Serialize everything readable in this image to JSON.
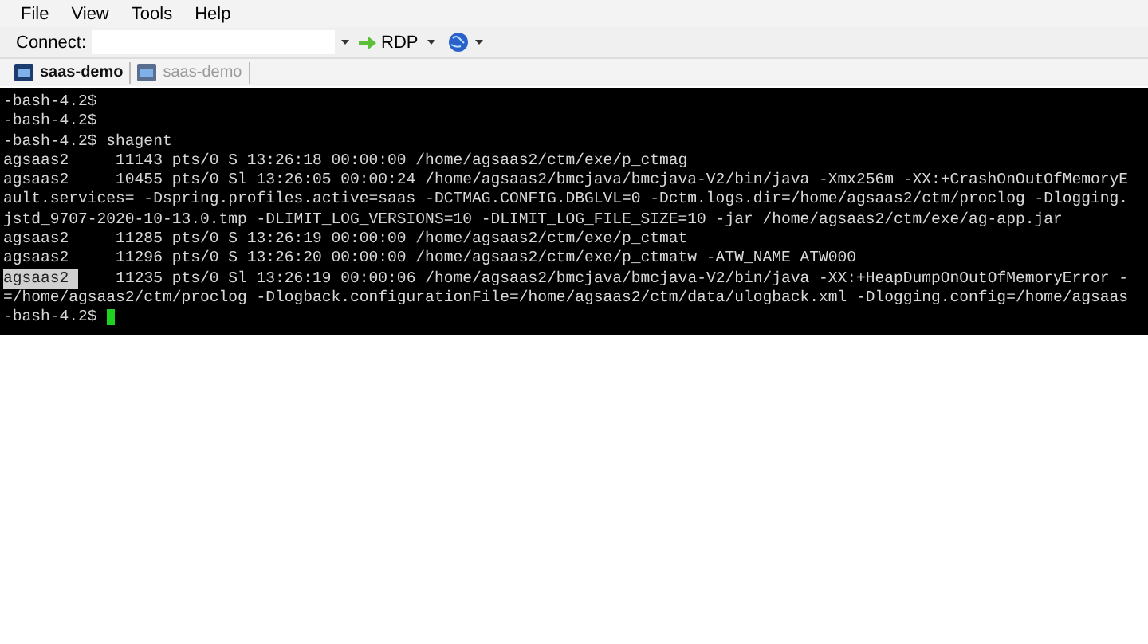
{
  "menu": [
    "File",
    "View",
    "Tools",
    "Help"
  ],
  "toolbar": {
    "connect_label": "Connect:",
    "rdp_label": "RDP"
  },
  "tabs": [
    {
      "label": "saas-demo",
      "selected": true
    },
    {
      "label": "saas-demo",
      "selected": false
    }
  ],
  "terminal": {
    "lines": [
      [
        {
          "text": "-bash-4.2$",
          "selected": false
        }
      ],
      [
        {
          "text": "-bash-4.2$",
          "selected": false
        }
      ],
      [
        {
          "text": "-bash-4.2$ shagent",
          "selected": false
        }
      ],
      [
        {
          "text": "agsaas2     11143 pts/0 S 13:26:18 00:00:00 /home/agsaas2/ctm/exe/p_ctmag",
          "selected": false
        }
      ],
      [
        {
          "text": "agsaas2     10455 pts/0 Sl 13:26:05 00:00:24 /home/agsaas2/bmcjava/bmcjava-V2/bin/java -Xmx256m -XX:+CrashOnOutOfMemoryE",
          "selected": false
        }
      ],
      [
        {
          "text": "ault.services= -Dspring.profiles.active=saas -DCTMAG.CONFIG.DBGLVL=0 -Dctm.logs.dir=/home/agsaas2/ctm/proclog -Dlogging.",
          "selected": false
        }
      ],
      [
        {
          "text": "jstd_9707-2020-10-13.0.tmp -DLIMIT_LOG_VERSIONS=10 -DLIMIT_LOG_FILE_SIZE=10 -jar /home/agsaas2/ctm/exe/ag-app.jar",
          "selected": false
        }
      ],
      [
        {
          "text": "agsaas2     11285 pts/0 S 13:26:19 00:00:00 /home/agsaas2/ctm/exe/p_ctmat",
          "selected": false
        }
      ],
      [
        {
          "text": "agsaas2     11296 pts/0 S 13:26:20 00:00:00 /home/agsaas2/ctm/exe/p_ctmatw -ATW_NAME ATW000",
          "selected": false
        }
      ],
      [
        {
          "text": "agsaas2 ",
          "selected": true
        },
        {
          "text": "    11235 pts/0 Sl 13:26:19 00:00:06 /home/agsaas2/bmcjava/bmcjava-V2/bin/java -XX:+HeapDumpOnOutOfMemoryError -",
          "selected": false
        }
      ],
      [
        {
          "text": "=/home/agsaas2/ctm/proclog -Dlogback.configurationFile=/home/agsaas2/ctm/data/ulogback.xml -Dlogging.config=/home/agsaas",
          "selected": false
        }
      ],
      [
        {
          "text": "-bash-4.2$ ",
          "selected": false
        }
      ]
    ],
    "cursor": true
  }
}
